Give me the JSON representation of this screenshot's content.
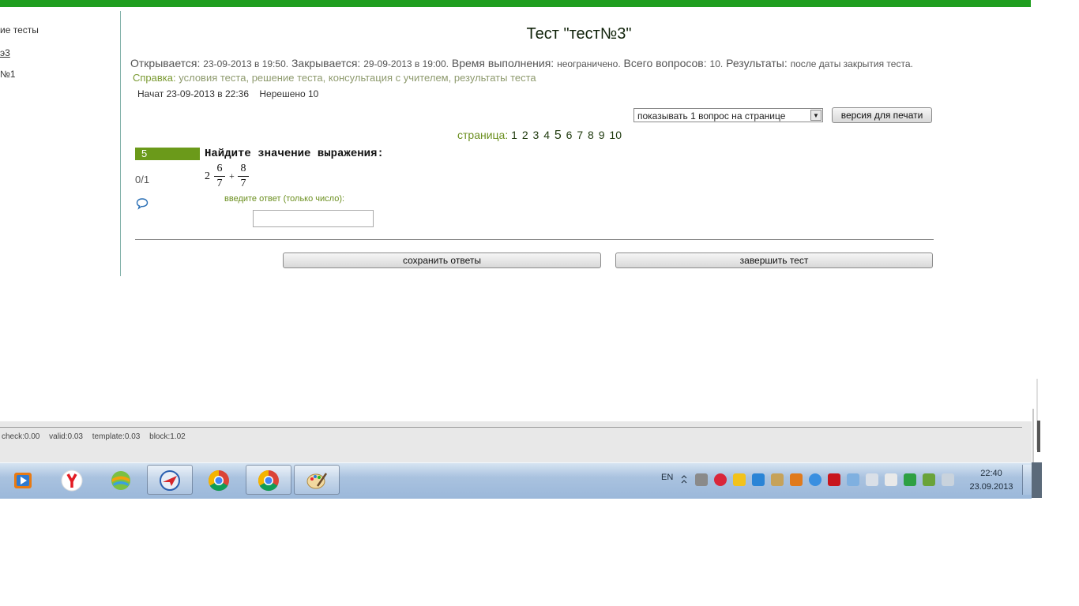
{
  "sidebar": {
    "items": [
      {
        "label": "ие тесты"
      },
      {
        "label": "э3"
      },
      {
        "label": "№1"
      }
    ]
  },
  "test": {
    "title": "Тест \"тест№3\"",
    "info": {
      "opens_label": "Открывается:",
      "opens_value": "23-09-2013 в 19:50.",
      "closes_label": "Закрывается:",
      "closes_value": "29-09-2013 в 19:00.",
      "duration_label": "Время выполнения:",
      "duration_value": "неограничено.",
      "questions_label": "Всего вопросов:",
      "questions_value": "10.",
      "results_label": "Результаты:",
      "results_value": "после даты закрытия теста."
    },
    "help": {
      "label": "Справка:",
      "links": [
        "условия теста,",
        "решение теста,",
        "консультация с учителем,",
        "результаты теста"
      ]
    },
    "started": "Начат 23-09-2013 в 22:36",
    "unsolved": "Нерешено 10",
    "per_page_select": "показывать 1 вопрос на странице",
    "print_button": "версия для печати",
    "pager": {
      "label": "страница:",
      "pages": [
        "1",
        "2",
        "3",
        "4",
        "5",
        "6",
        "7",
        "8",
        "9",
        "10"
      ],
      "current": "5"
    }
  },
  "question": {
    "number": "5",
    "score": "0/1",
    "text": "Найдите значение выражения:",
    "formula": {
      "whole": "2",
      "frac1_num": "6",
      "frac1_den": "7",
      "operator": "+",
      "frac2_num": "8",
      "frac2_den": "7"
    },
    "answer_label": "введите ответ (только число):",
    "answer_value": ""
  },
  "actions": {
    "save": "сохранить ответы",
    "finish": "завершить тест"
  },
  "footer": {
    "stats": [
      "check:0.00",
      "valid:0.03",
      "template:0.03",
      "block:1.02"
    ]
  },
  "taskbar": {
    "apps": [
      "windows-media-player-icon",
      "yandex-browser-icon",
      "app-globe-icon",
      "app-plane-icon",
      "chrome-icon",
      "chrome-icon",
      "paint-icon"
    ],
    "language": "EN",
    "time": "22:40",
    "date": "23.09.2013"
  },
  "colors": {
    "top_bar": "#1f9e1f",
    "accent_green": "#6b9a1a",
    "link_green": "#6b8f1f"
  }
}
